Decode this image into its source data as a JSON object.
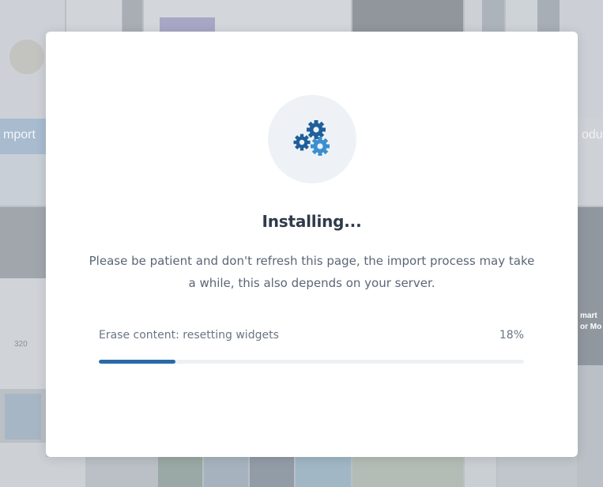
{
  "background": {
    "visible_texts": [
      "mport",
      "odu",
      "320",
      "mart",
      "or Mo"
    ]
  },
  "modal": {
    "icon": "gears-icon",
    "title": "Installing...",
    "description": "Please be patient and don't refresh this page, the import process may take a while, this also depends on your server.",
    "status_text": "Erase content: resetting widgets",
    "progress_percent_label": "18%",
    "progress_fraction": 0.18,
    "colors": {
      "accent": "#2a6aa8",
      "gear_dark": "#1f5f9a",
      "gear_light": "#3a8fd0"
    }
  }
}
